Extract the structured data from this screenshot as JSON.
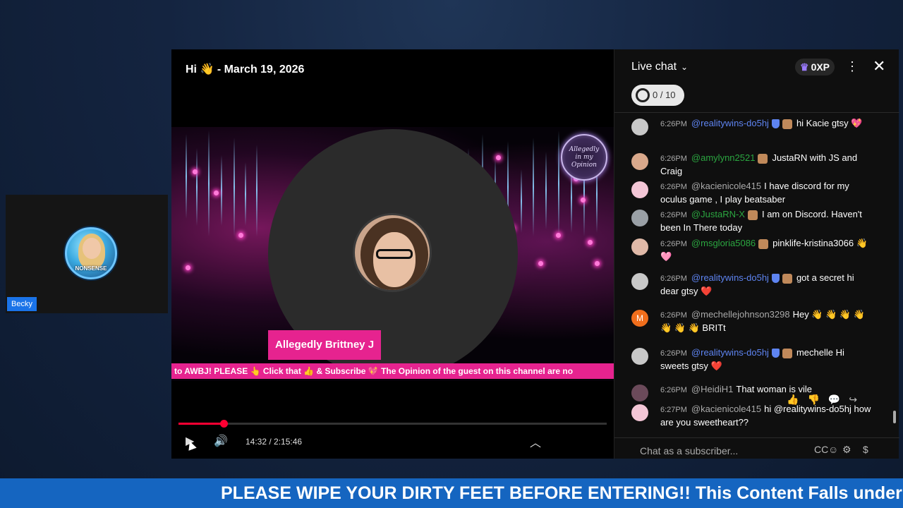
{
  "guest": {
    "name": "Becky",
    "avatar_text": "NONSENSE"
  },
  "player": {
    "title": "Hi 👋 - March 19, 2026",
    "host_name": "Allegedly Brittney J",
    "logo_text": "Allegedly in my Opinion",
    "ticker": "to AWBJ! PLEASE 👆 Click that 👍 & Subscribe 💖 The Opinion of the guest on this channel are no",
    "time": "14:32 / 2:15:46",
    "progress": 0.105,
    "icons": {
      "play": "play-icon",
      "volume": "volume-icon",
      "expand": "chevron-up-icon"
    }
  },
  "chat": {
    "title": "Live chat",
    "xp": "0XP",
    "goal": "0 / 10",
    "input_placeholder": "Chat as a subscriber...",
    "messages": [
      {
        "time": "6:26PM",
        "author": "@realitywins-do5hj",
        "author_type": "mod",
        "text": "hi Kacie gtsy 💖",
        "avatar_color": "#c8c8c8"
      },
      {
        "time": "6:26PM",
        "author": "@amylynn2521",
        "author_type": "member",
        "text": "JustaRN with JS and Craig",
        "avatar_color": "#d9a88b"
      },
      {
        "time": "6:26PM",
        "author": "@kacienicole415",
        "author_type": "normal",
        "text": "I have discord for my oculus game , I play beatsaber",
        "avatar_color": "#f3c6d6"
      },
      {
        "time": "6:26PM",
        "author": "@JustaRN-X",
        "author_type": "member",
        "text": "I am on Discord. Haven't been In There today",
        "avatar_color": "#9aa0a6"
      },
      {
        "time": "6:26PM",
        "author": "@msgloria5086",
        "author_type": "member",
        "text": "pinklife-kristina3066 👋 🩷",
        "avatar_color": "#e0b9a8"
      },
      {
        "time": "6:26PM",
        "author": "@realitywins-do5hj",
        "author_type": "mod",
        "text": "got a secret hi dear gtsy ❤️",
        "avatar_color": "#c8c8c8"
      },
      {
        "time": "6:26PM",
        "author": "@mechellejohnson3298",
        "author_type": "normal",
        "text": "Hey 👋 👋 👋 👋 👋 👋 👋 BRITt",
        "avatar_color": "#f06e1c",
        "avatar_letter": "M"
      },
      {
        "time": "6:26PM",
        "author": "@realitywins-do5hj",
        "author_type": "mod",
        "text": "mechelle Hi sweets gtsy ❤️",
        "avatar_color": "#c8c8c8"
      },
      {
        "time": "6:26PM",
        "author": "@HeidiH1",
        "author_type": "normal",
        "text": "That woman is vile",
        "avatar_color": "#6b4a5a"
      },
      {
        "time": "6:27PM",
        "author": "@kacienicole415",
        "author_type": "normal",
        "text": "hi @realitywins-do5hj how are you sweetheart??",
        "avatar_color": "#f3c6d6"
      }
    ]
  },
  "banner": "PLEASE WIPE YOUR DIRTY FEET BEFORE ENTERING!! This Content Falls under"
}
